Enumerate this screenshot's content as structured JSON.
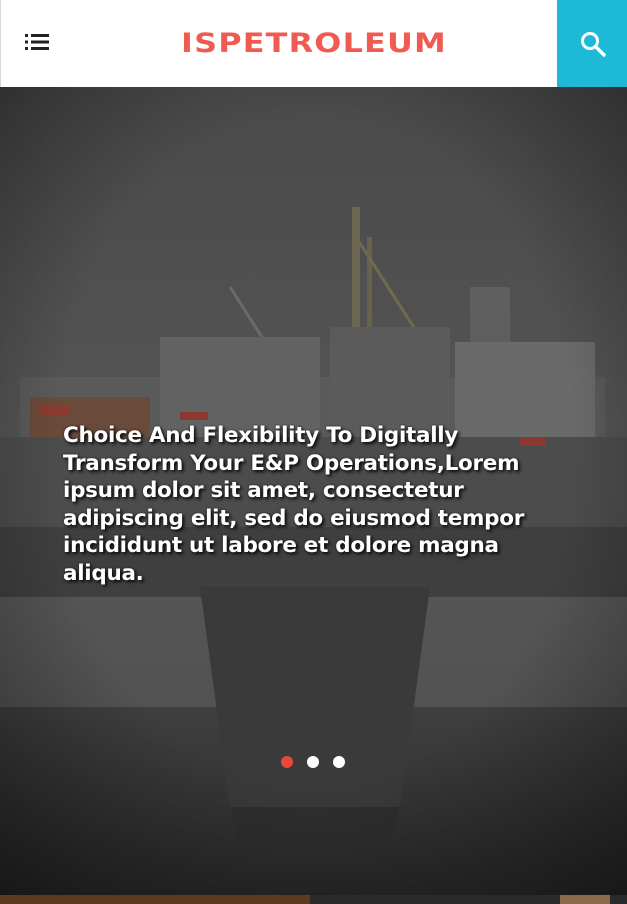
{
  "header": {
    "brand": "ISPETROLEUM",
    "menu_icon": "menu-list-icon",
    "search_icon": "search-icon"
  },
  "hero": {
    "text": "Choice And Flexibility To Digitally Transform Your E&P Operations,Lorem ipsum dolor sit amet, consectetur adipiscing elit, sed do eiusmod tempor incididunt ut labore et dolore magna aliqua.",
    "slide_dots": [
      {
        "active": true
      },
      {
        "active": false
      },
      {
        "active": false
      }
    ]
  },
  "colors": {
    "brand": "#f05a50",
    "search_bg": "#1fb9d8",
    "dot_active": "#e8473c"
  }
}
